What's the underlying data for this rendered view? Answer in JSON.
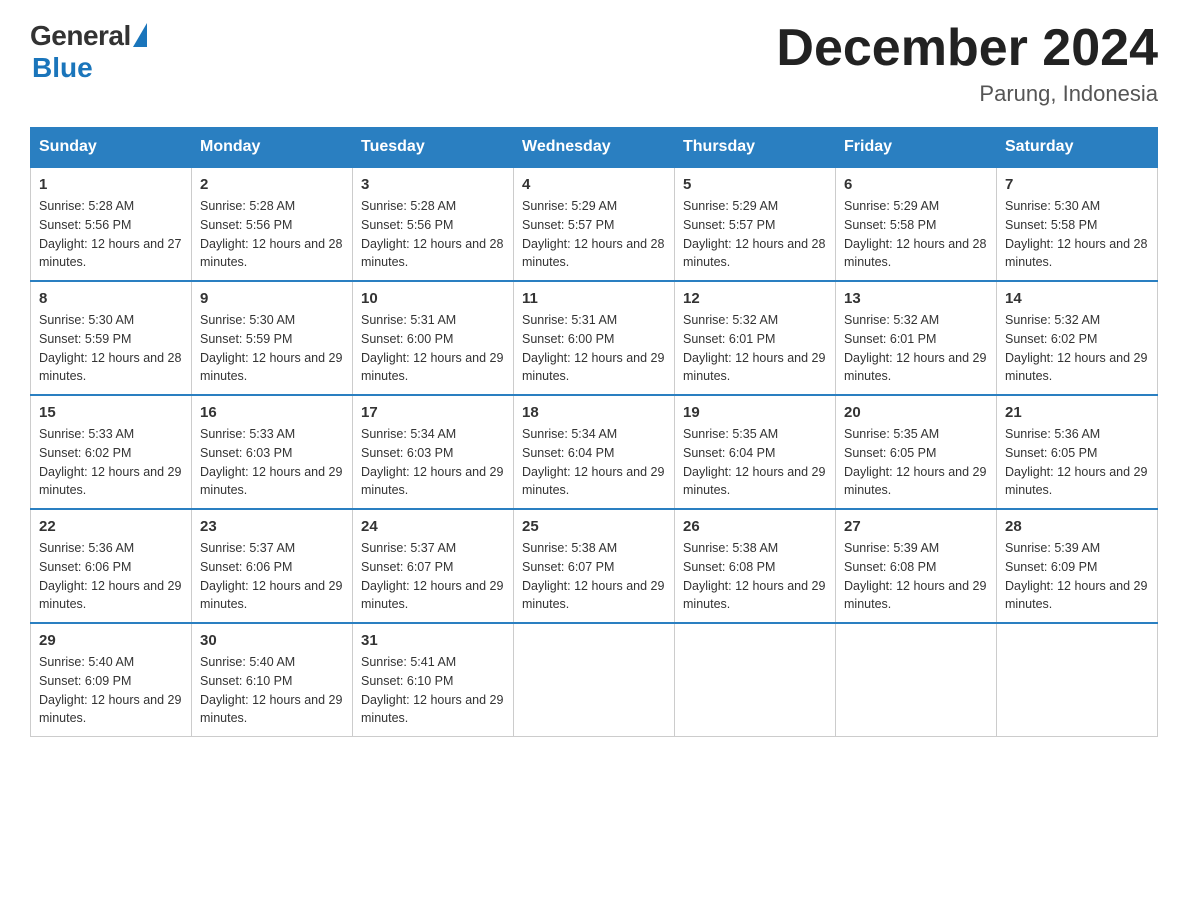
{
  "header": {
    "logo_general": "General",
    "logo_blue": "Blue",
    "title": "December 2024",
    "location": "Parung, Indonesia"
  },
  "days_of_week": [
    "Sunday",
    "Monday",
    "Tuesday",
    "Wednesday",
    "Thursday",
    "Friday",
    "Saturday"
  ],
  "weeks": [
    [
      {
        "day": "1",
        "sunrise": "5:28 AM",
        "sunset": "5:56 PM",
        "daylight": "12 hours and 27 minutes."
      },
      {
        "day": "2",
        "sunrise": "5:28 AM",
        "sunset": "5:56 PM",
        "daylight": "12 hours and 28 minutes."
      },
      {
        "day": "3",
        "sunrise": "5:28 AM",
        "sunset": "5:56 PM",
        "daylight": "12 hours and 28 minutes."
      },
      {
        "day": "4",
        "sunrise": "5:29 AM",
        "sunset": "5:57 PM",
        "daylight": "12 hours and 28 minutes."
      },
      {
        "day": "5",
        "sunrise": "5:29 AM",
        "sunset": "5:57 PM",
        "daylight": "12 hours and 28 minutes."
      },
      {
        "day": "6",
        "sunrise": "5:29 AM",
        "sunset": "5:58 PM",
        "daylight": "12 hours and 28 minutes."
      },
      {
        "day": "7",
        "sunrise": "5:30 AM",
        "sunset": "5:58 PM",
        "daylight": "12 hours and 28 minutes."
      }
    ],
    [
      {
        "day": "8",
        "sunrise": "5:30 AM",
        "sunset": "5:59 PM",
        "daylight": "12 hours and 28 minutes."
      },
      {
        "day": "9",
        "sunrise": "5:30 AM",
        "sunset": "5:59 PM",
        "daylight": "12 hours and 29 minutes."
      },
      {
        "day": "10",
        "sunrise": "5:31 AM",
        "sunset": "6:00 PM",
        "daylight": "12 hours and 29 minutes."
      },
      {
        "day": "11",
        "sunrise": "5:31 AM",
        "sunset": "6:00 PM",
        "daylight": "12 hours and 29 minutes."
      },
      {
        "day": "12",
        "sunrise": "5:32 AM",
        "sunset": "6:01 PM",
        "daylight": "12 hours and 29 minutes."
      },
      {
        "day": "13",
        "sunrise": "5:32 AM",
        "sunset": "6:01 PM",
        "daylight": "12 hours and 29 minutes."
      },
      {
        "day": "14",
        "sunrise": "5:32 AM",
        "sunset": "6:02 PM",
        "daylight": "12 hours and 29 minutes."
      }
    ],
    [
      {
        "day": "15",
        "sunrise": "5:33 AM",
        "sunset": "6:02 PM",
        "daylight": "12 hours and 29 minutes."
      },
      {
        "day": "16",
        "sunrise": "5:33 AM",
        "sunset": "6:03 PM",
        "daylight": "12 hours and 29 minutes."
      },
      {
        "day": "17",
        "sunrise": "5:34 AM",
        "sunset": "6:03 PM",
        "daylight": "12 hours and 29 minutes."
      },
      {
        "day": "18",
        "sunrise": "5:34 AM",
        "sunset": "6:04 PM",
        "daylight": "12 hours and 29 minutes."
      },
      {
        "day": "19",
        "sunrise": "5:35 AM",
        "sunset": "6:04 PM",
        "daylight": "12 hours and 29 minutes."
      },
      {
        "day": "20",
        "sunrise": "5:35 AM",
        "sunset": "6:05 PM",
        "daylight": "12 hours and 29 minutes."
      },
      {
        "day": "21",
        "sunrise": "5:36 AM",
        "sunset": "6:05 PM",
        "daylight": "12 hours and 29 minutes."
      }
    ],
    [
      {
        "day": "22",
        "sunrise": "5:36 AM",
        "sunset": "6:06 PM",
        "daylight": "12 hours and 29 minutes."
      },
      {
        "day": "23",
        "sunrise": "5:37 AM",
        "sunset": "6:06 PM",
        "daylight": "12 hours and 29 minutes."
      },
      {
        "day": "24",
        "sunrise": "5:37 AM",
        "sunset": "6:07 PM",
        "daylight": "12 hours and 29 minutes."
      },
      {
        "day": "25",
        "sunrise": "5:38 AM",
        "sunset": "6:07 PM",
        "daylight": "12 hours and 29 minutes."
      },
      {
        "day": "26",
        "sunrise": "5:38 AM",
        "sunset": "6:08 PM",
        "daylight": "12 hours and 29 minutes."
      },
      {
        "day": "27",
        "sunrise": "5:39 AM",
        "sunset": "6:08 PM",
        "daylight": "12 hours and 29 minutes."
      },
      {
        "day": "28",
        "sunrise": "5:39 AM",
        "sunset": "6:09 PM",
        "daylight": "12 hours and 29 minutes."
      }
    ],
    [
      {
        "day": "29",
        "sunrise": "5:40 AM",
        "sunset": "6:09 PM",
        "daylight": "12 hours and 29 minutes."
      },
      {
        "day": "30",
        "sunrise": "5:40 AM",
        "sunset": "6:10 PM",
        "daylight": "12 hours and 29 minutes."
      },
      {
        "day": "31",
        "sunrise": "5:41 AM",
        "sunset": "6:10 PM",
        "daylight": "12 hours and 29 minutes."
      },
      null,
      null,
      null,
      null
    ]
  ]
}
